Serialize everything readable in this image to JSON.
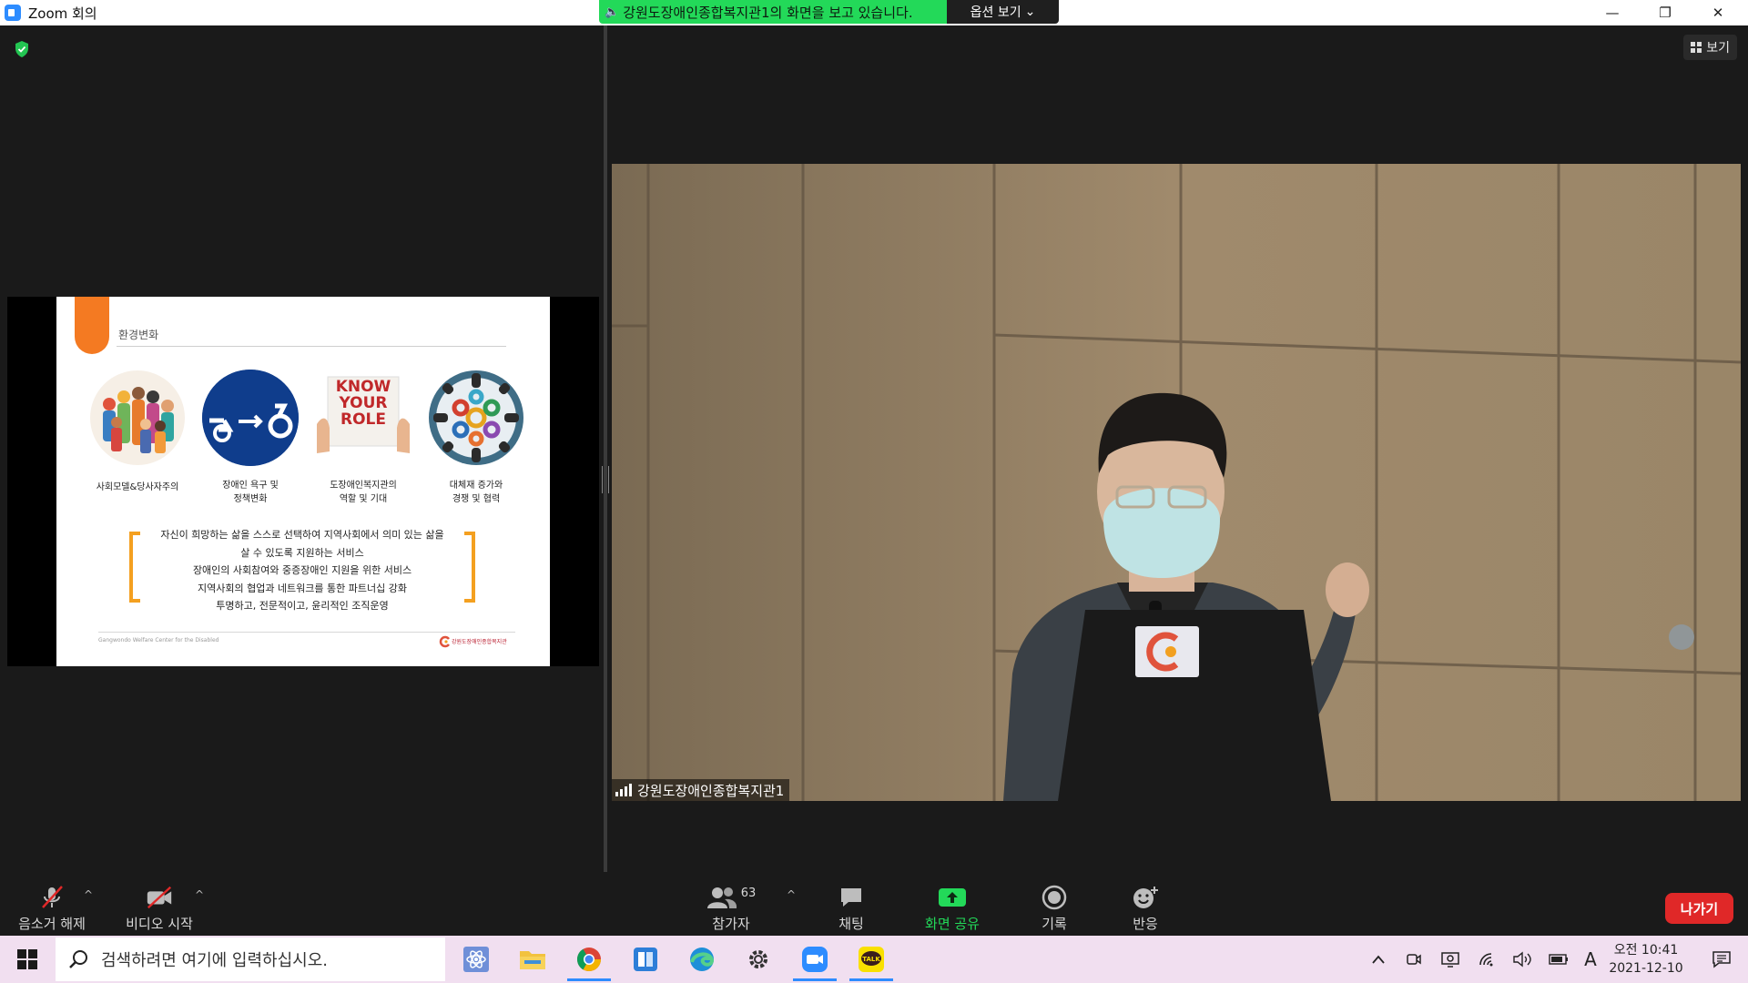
{
  "window": {
    "title": "Zoom 회의",
    "controls": {
      "minimize": "—",
      "restore": "❐",
      "close": "✕"
    }
  },
  "share_banner": {
    "text": "강원도장애인종합복지관1의 화면을 보고 있습니다.",
    "options_label": "옵션 보기",
    "color": "#23d959"
  },
  "view_button": {
    "label": "보기"
  },
  "slide": {
    "heading": "환경변화",
    "captions": [
      [
        "사회모델&당사자주의"
      ],
      [
        "장애인 욕구 및",
        "정책변화"
      ],
      [
        "도장애인복지관의",
        "역할 및 기대"
      ],
      [
        "대체재 증가와",
        "경쟁 및 협력"
      ]
    ],
    "know_your_role": [
      "KNOW",
      "YOUR",
      "ROLE"
    ],
    "paragraph": [
      "자신이 희망하는 삶을 스스로 선택하여 지역사회에서 의미 있는 삶을",
      "살 수 있도록 지원하는 서비스",
      "장애인의 사회참여와 중증장애인 지원을 위한 서비스",
      "지역사회의 협업과 네트워크를 통한 파트너십 강화",
      "투명하고, 전문적이고, 윤리적인 조직운영"
    ],
    "footer_left": "Gangwondo Welfare Center for the Disabled",
    "footer_logo": "강원도장애인종합복지관",
    "accent_color": "#f47a22",
    "bracket_color": "#f4a020"
  },
  "video": {
    "participant_name": "강원도장애인종합복지관1"
  },
  "toolbar": {
    "unmute": "음소거 해제",
    "start_video": "비디오 시작",
    "participants": "참가자",
    "participant_count": "63",
    "chat": "채팅",
    "share_screen": "화면 공유",
    "record": "기록",
    "reactions": "반응",
    "leave": "나가기",
    "share_color": "#23d959",
    "leave_color": "#e02828"
  },
  "taskbar": {
    "search_placeholder": "검색하려면 여기에 입력하십시오.",
    "ime": "A",
    "clock_period_time": "오전 10:41",
    "clock_date": "2021-12-10"
  }
}
